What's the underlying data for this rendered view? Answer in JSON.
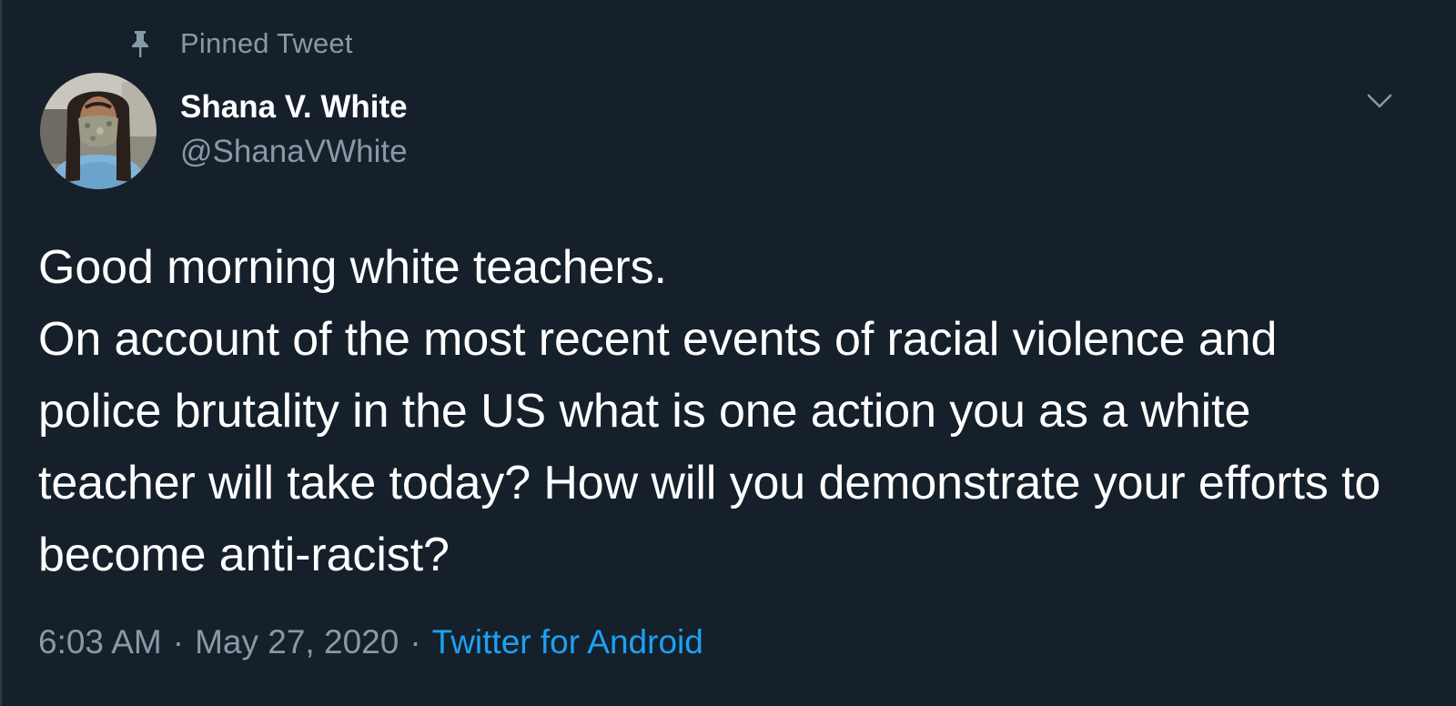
{
  "tweet": {
    "pinned_label": "Pinned Tweet",
    "author": {
      "display_name": "Shana V. White",
      "handle": "@ShanaVWhite",
      "avatar": "avatar-photo"
    },
    "text": "Good morning white teachers.\nOn account of the most recent events of racial violence and police brutality in the US what is one action you as a white teacher will take today? How will you demonstrate your efforts to become anti-racist?",
    "time": "6:03 AM",
    "date": "May 27, 2020",
    "separator": "·",
    "source": "Twitter for Android"
  },
  "icons": {
    "pin": "pin-icon",
    "menu": "chevron-down-icon"
  },
  "colors": {
    "background": "#15202b",
    "primary_text": "#ffffff",
    "secondary_text": "#8899a6",
    "accent": "#1da1f2"
  }
}
